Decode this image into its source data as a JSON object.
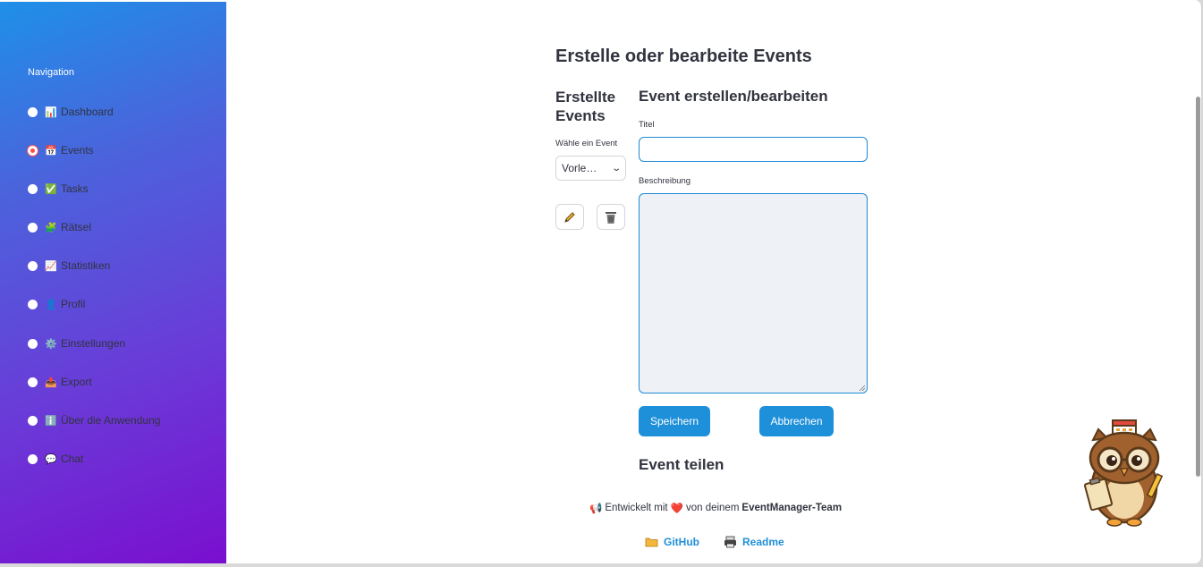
{
  "sidebar": {
    "title": "Navigation",
    "items": [
      {
        "emoji": "📊",
        "label": "Dashboard",
        "selected": false
      },
      {
        "emoji": "📅",
        "label": "Events",
        "selected": true
      },
      {
        "emoji": "✅",
        "label": "Tasks",
        "selected": false
      },
      {
        "emoji": "🧩",
        "label": "Rätsel",
        "selected": false
      },
      {
        "emoji": "📈",
        "label": "Statistiken",
        "selected": false
      },
      {
        "emoji": "👤",
        "label": "Profil",
        "selected": false
      },
      {
        "emoji": "⚙️",
        "label": "Einstellungen",
        "selected": false
      },
      {
        "emoji": "📤",
        "label": "Export",
        "selected": false
      },
      {
        "emoji": "ℹ️",
        "label": "Über die Anwendung",
        "selected": false
      },
      {
        "emoji": "💬",
        "label": "Chat",
        "selected": false
      }
    ]
  },
  "main": {
    "page_title": "Erstelle oder bearbeite Events",
    "left_title": "Erstellte Events",
    "select_label": "Wähle ein Event",
    "select_value": "Vorle…",
    "form_title": "Event erstellen/bearbeiten",
    "title_label": "Titel",
    "title_value": "",
    "description_label": "Beschreibung",
    "description_value": "",
    "save_label": "Speichern",
    "cancel_label": "Abbrechen",
    "share_title": "Event teilen"
  },
  "footer": {
    "prefix_emoji": "📢",
    "text_before": "Entwickelt mit",
    "heart": "❤️",
    "text_middle": "von deinem",
    "team": "EventManager-Team",
    "github_label": "GitHub",
    "readme_label": "Readme"
  },
  "colors": {
    "accent": "#1e8fd9",
    "radio_selected": "#ff4b4b"
  }
}
